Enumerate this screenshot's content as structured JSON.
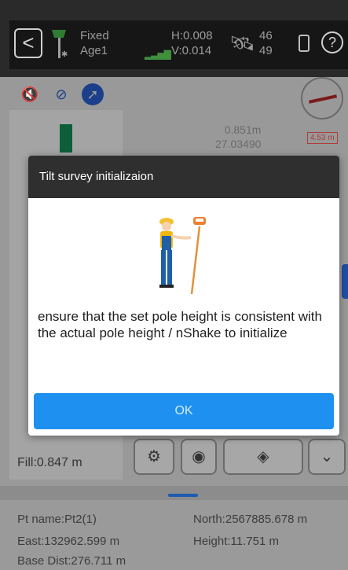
{
  "status": {
    "fix_label": "Fixed",
    "age_label": "Age1",
    "h_precision": "H:0.008",
    "v_precision": "V:0.014",
    "sats_tracked": "46",
    "sats_visible": "49",
    "help_glyph": "?",
    "back_glyph": "<"
  },
  "map": {
    "distance_label": "0.851m",
    "distance_label_2": "27.03490",
    "compass_offset": "4.53 m"
  },
  "tools": {
    "fill_label": "Fill:0.847 m",
    "settings_icon": "gear-icon",
    "camera_icon": "camera-icon",
    "layers_icon": "layers-icon",
    "expand_icon": "double-chevron-down-icon"
  },
  "point_info": {
    "pt_name": "Pt name:Pt2(1)",
    "north": "North:2567885.678 m",
    "east": "East:132962.599 m",
    "height": "Height:11.751 m",
    "base_dist": "Base Dist:276.711 m"
  },
  "dialog": {
    "title": "Tilt survey initializaion",
    "message": "ensure that the set pole height is consistent with the actual pole height / nShake to initialize",
    "ok_label": "OK"
  },
  "colors": {
    "accent": "#1e90f0",
    "status_bar": "#161616",
    "dialog_header": "#2f2f2f",
    "fix_green": "#0d5f3a"
  }
}
